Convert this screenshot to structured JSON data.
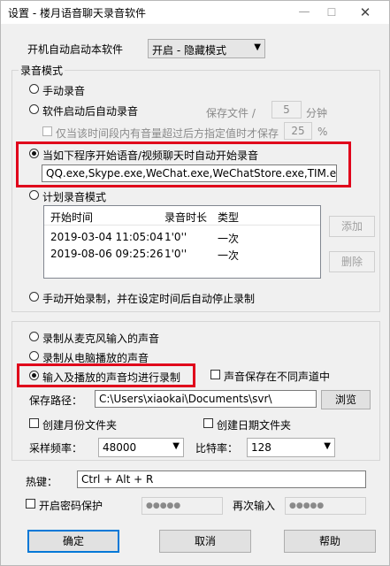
{
  "window": {
    "title": "设置 - 楼月语音聊天录音软件",
    "minimize": "—",
    "maximize": "☐",
    "close": "✕"
  },
  "startup": {
    "label": "开机自动启动本软件",
    "value": "开启 - 隐藏模式"
  },
  "record_mode": {
    "title": "录音模式",
    "manual": "手动录音",
    "auto_on_start": "软件启动后自动录音",
    "save_every_label": "保存文件 /",
    "save_every_value": "5",
    "save_every_unit": "分钟",
    "only_volume_label": "仅当该时间段内有音量超过后方指定值时才保存",
    "only_volume_value": "25",
    "only_volume_unit": "%",
    "auto_on_chat": "当如下程序开始语音/视频聊天时自动开始录音",
    "programs": "QQ.exe,Skype.exe,WeChat.exe,WeChatStore.exe,TIM.exe",
    "schedule": "计划录音模式",
    "schedule_table": {
      "columns": [
        "开始时间",
        "录音时长",
        "类型"
      ],
      "rows": [
        [
          "2019-03-04 11:05:04",
          "1'0''",
          "一次"
        ],
        [
          "2019-08-06 09:25:26",
          "1'0''",
          "一次"
        ]
      ]
    },
    "add_button": "添加",
    "delete_button": "删除",
    "manual_timed": "手动开始录制，并在设定时间后自动停止录制"
  },
  "source": {
    "mic": "录制从麦克风输入的声音",
    "pc": "录制从电脑播放的声音",
    "both": "输入及播放的声音均进行录制",
    "split_channels": "声音保存在不同声道中",
    "save_path_label": "保存路径：",
    "save_path_value": "C:\\Users\\xiaokai\\Documents\\svr\\",
    "browse": "浏览",
    "month_folder": "创建月份文件夹",
    "date_folder": "创建日期文件夹",
    "sample_rate_label": "采样频率：",
    "sample_rate_value": "48000",
    "bitrate_label": "比特率：",
    "bitrate_value": "128"
  },
  "hotkey": {
    "label": "热键：",
    "value": "Ctrl + Alt + R"
  },
  "password": {
    "label": "开启密码保护",
    "value": "●●●●●",
    "again_label": "再次输入",
    "again_value": "●●●●●"
  },
  "buttons": {
    "ok": "确定",
    "cancel": "取消",
    "help": "帮助"
  },
  "colors": {
    "highlight": "#e0001b",
    "default_button_border": "#0078d7"
  }
}
